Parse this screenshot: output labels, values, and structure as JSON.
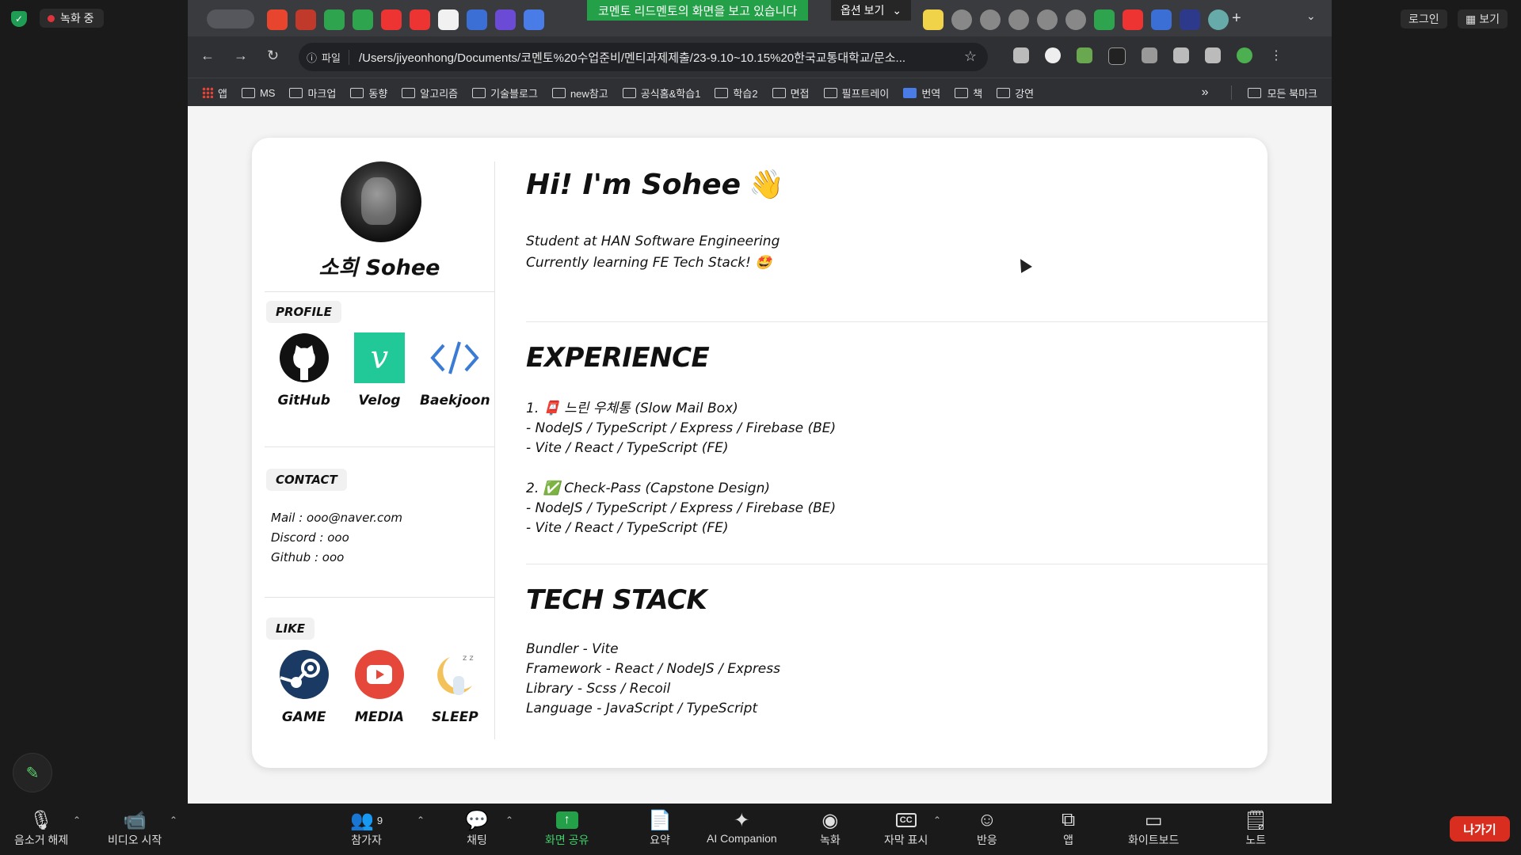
{
  "zoom": {
    "recording_label": "녹화 중",
    "top_right": {
      "login": "로그인",
      "view": "보기"
    },
    "share_banner": "코멘토 리드멘토의 화면을 보고 있습니다",
    "options_label": "옵션 보기",
    "bottom": {
      "mute": "음소거 해제",
      "video": "비디오 시작",
      "participants": "참가자",
      "participants_count": "9",
      "chat": "채팅",
      "share": "화면 공유",
      "summary": "요약",
      "ai": "AI Companion",
      "record": "녹화",
      "captions": "자막 표시",
      "reactions": "반응",
      "apps": "앱",
      "whiteboard": "화이트보드",
      "notes": "노트",
      "leave": "나가기"
    }
  },
  "browser": {
    "info_chip": "파일",
    "url": "/Users/jiyeonhong/Documents/코멘토%20수업준비/멘티과제제출/23-9.10~10.15%20한국교통대학교/문소...",
    "bookmarks": [
      "앱",
      "MS",
      "마크업",
      "동향",
      "알고리즘",
      "기술블로그",
      "new참고",
      "공식홈&학습1",
      "학습2",
      "면접",
      "필프트레이",
      "번역",
      "책",
      "강연"
    ],
    "bookmarks_more": "»",
    "all_bookmarks": "모든 북마크"
  },
  "profile": {
    "name": "소희 Sohee",
    "profile_tag": "PROFILE",
    "profile_links": [
      {
        "label": "GitHub",
        "icon": "github-icon"
      },
      {
        "label": "Velog",
        "icon": "velog-icon"
      },
      {
        "label": "Baekjoon",
        "icon": "code-icon"
      }
    ],
    "contact_tag": "CONTACT",
    "contact": [
      "Mail : ooo@naver.com",
      "Discord : ooo",
      "Github : ooo"
    ],
    "like_tag": "LIKE",
    "likes": [
      {
        "label": "GAME",
        "icon": "steam-icon"
      },
      {
        "label": "MEDIA",
        "icon": "youtube-icon"
      },
      {
        "label": "SLEEP",
        "icon": "sleep-moon-icon"
      }
    ]
  },
  "main": {
    "greeting": "Hi! I'm Sohee",
    "greeting_emoji": "👋",
    "intro": [
      "Student at HAN Software Engineering",
      "Currently learning FE Tech Stack! 🤩"
    ],
    "experience_title": "EXPERIENCE",
    "experience": [
      {
        "title": "1. 📮 느린 우체통 (Slow Mail Box)",
        "lines": [
          "- NodeJS / TypeScript / Express / Firebase (BE)",
          "- Vite / React / TypeScript (FE)"
        ]
      },
      {
        "title": "2. ✅ Check-Pass (Capstone Design)",
        "lines": [
          "- NodeJS / TypeScript / Express / Firebase (BE)",
          "- Vite / React / TypeScript (FE)"
        ]
      }
    ],
    "tech_title": "TECH STACK",
    "tech": [
      "Bundler - Vite",
      "Framework - React / NodeJS / Express",
      "Library - Scss / Recoil",
      "Language - JavaScript / TypeScript"
    ]
  },
  "colors": {
    "share_green": "#24a148",
    "leave_red": "#d92d20",
    "velog_green": "#20c997",
    "youtube_red": "#e5483b"
  }
}
